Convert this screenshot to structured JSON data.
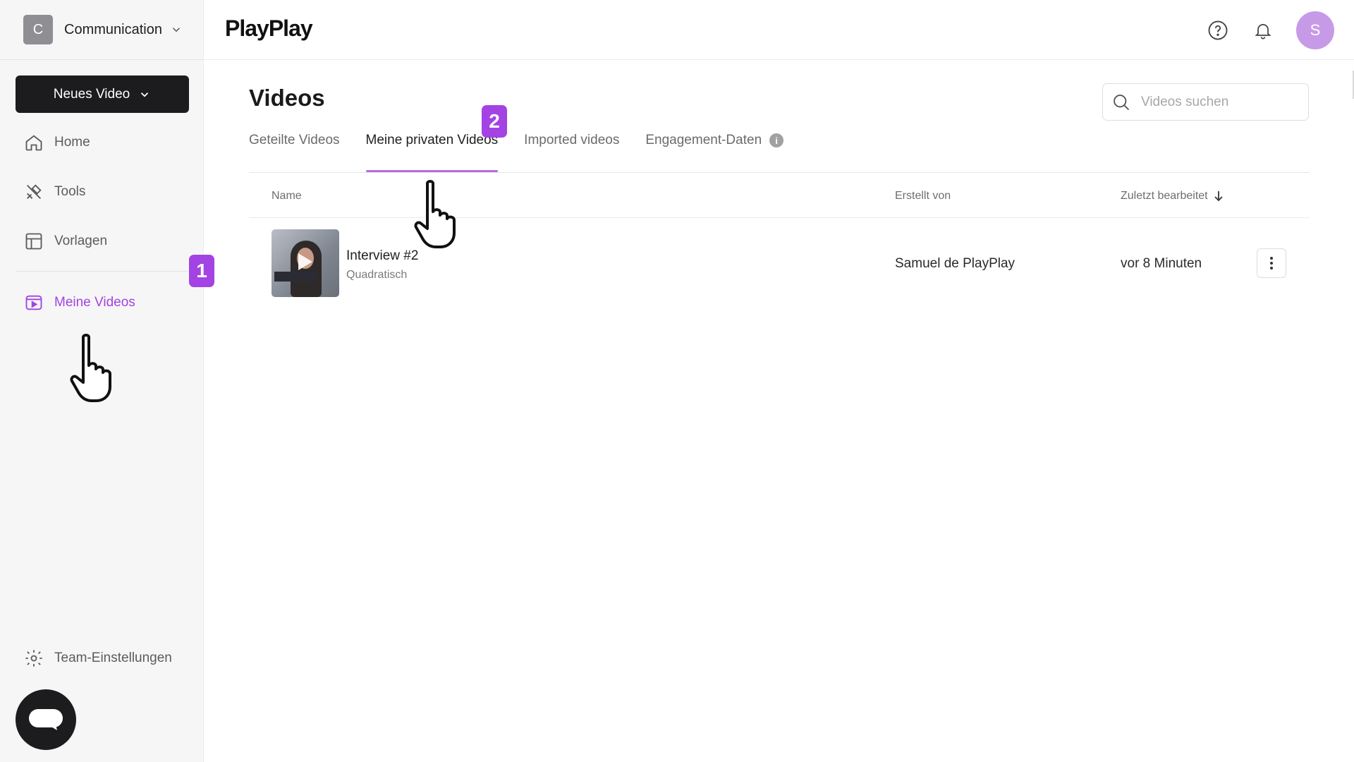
{
  "team": {
    "initial": "C",
    "name": "Communication"
  },
  "sidebar": {
    "new_video_label": "Neues Video",
    "items": [
      {
        "label": "Home",
        "icon": "home-icon"
      },
      {
        "label": "Tools",
        "icon": "tools-icon"
      },
      {
        "label": "Vorlagen",
        "icon": "templates-icon"
      },
      {
        "label": "Meine Videos",
        "icon": "video-icon",
        "active": true
      }
    ],
    "settings_label": "Team-Einstellungen"
  },
  "header": {
    "logo": "PlayPlay",
    "user_initial": "S"
  },
  "main": {
    "title": "Videos",
    "search_placeholder": "Videos suchen",
    "tabs": [
      {
        "label": "Geteilte Videos"
      },
      {
        "label": "Meine privaten Videos",
        "active": true
      },
      {
        "label": "Imported videos"
      },
      {
        "label": "Engagement-Daten",
        "info": "i"
      }
    ],
    "columns": {
      "name": "Name",
      "created_by": "Erstellt von",
      "last_edited": "Zuletzt bearbeitet"
    },
    "rows": [
      {
        "title": "Interview #2",
        "format": "Quadratisch",
        "creator": "Samuel de PlayPlay",
        "edited": "vor 8 Minuten"
      }
    ]
  },
  "tutorial": {
    "step1": "1",
    "step2": "2"
  },
  "colors": {
    "accent": "#a343e3",
    "dark": "#1c1c1e",
    "sidebar_bg": "#f6f6f6"
  }
}
